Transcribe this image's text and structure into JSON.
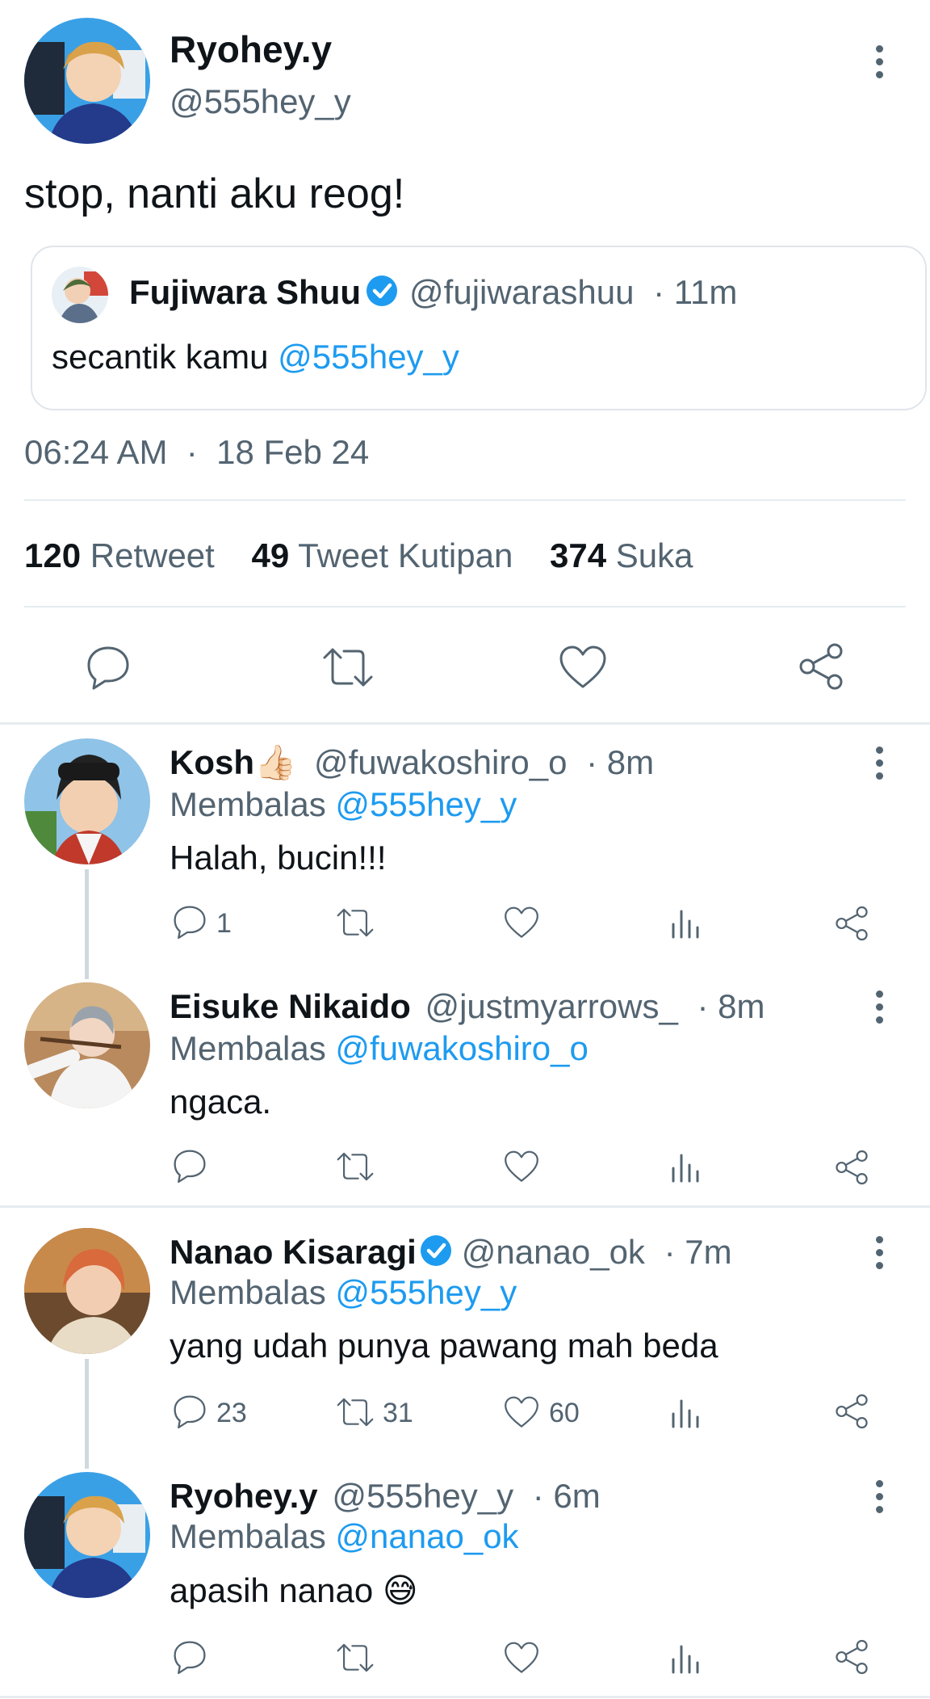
{
  "main_tweet": {
    "name": "Ryohey.y",
    "handle": "@555hey_y",
    "text": "stop, nanti aku reog!",
    "quote": {
      "name": "Fujiwara Shuu",
      "handle": "@fujiwarashuu",
      "time": "· 11m",
      "text": "secantik kamu ",
      "mention": "@555hey_y"
    },
    "timestamp": "06:24 AM  ·  18 Feb 24",
    "stats": {
      "retweets": "120",
      "retweets_label": "Retweet",
      "quotes": "49",
      "quotes_label": "Tweet Kutipan",
      "likes": "374",
      "likes_label": "Suka"
    }
  },
  "replies": [
    {
      "name": "Kosh👍🏻",
      "handle": "@fuwakoshiro_o",
      "time": "· 8m",
      "reply_prefix": "Membalas ",
      "reply_to": "@555hey_y",
      "text": "Halah, bucin!!!",
      "reply_count": "1",
      "retweet_count": "",
      "like_count": ""
    },
    {
      "name": "Eisuke Nikaido",
      "handle": "@justmyarrows_",
      "time": "· 8m",
      "reply_prefix": "Membalas ",
      "reply_to": "@fuwakoshiro_o",
      "text": "ngaca.",
      "reply_count": "",
      "retweet_count": "",
      "like_count": ""
    },
    {
      "name": "Nanao Kisaragi",
      "handle": "@nanao_ok",
      "time": "· 7m",
      "reply_prefix": "Membalas ",
      "reply_to": "@555hey_y",
      "text": "yang udah punya pawang mah beda",
      "reply_count": "23",
      "retweet_count": "31",
      "like_count": "60"
    },
    {
      "name": "Ryohey.y",
      "handle": "@555hey_y",
      "time": "· 6m",
      "reply_prefix": "Membalas ",
      "reply_to": "@nanao_ok",
      "text": "apasih nanao 😅",
      "reply_count": "",
      "retweet_count": "",
      "like_count": ""
    }
  ],
  "colors": {
    "accent": "#1d9bf0",
    "muted": "#536471",
    "divider": "#e6ecf0"
  }
}
